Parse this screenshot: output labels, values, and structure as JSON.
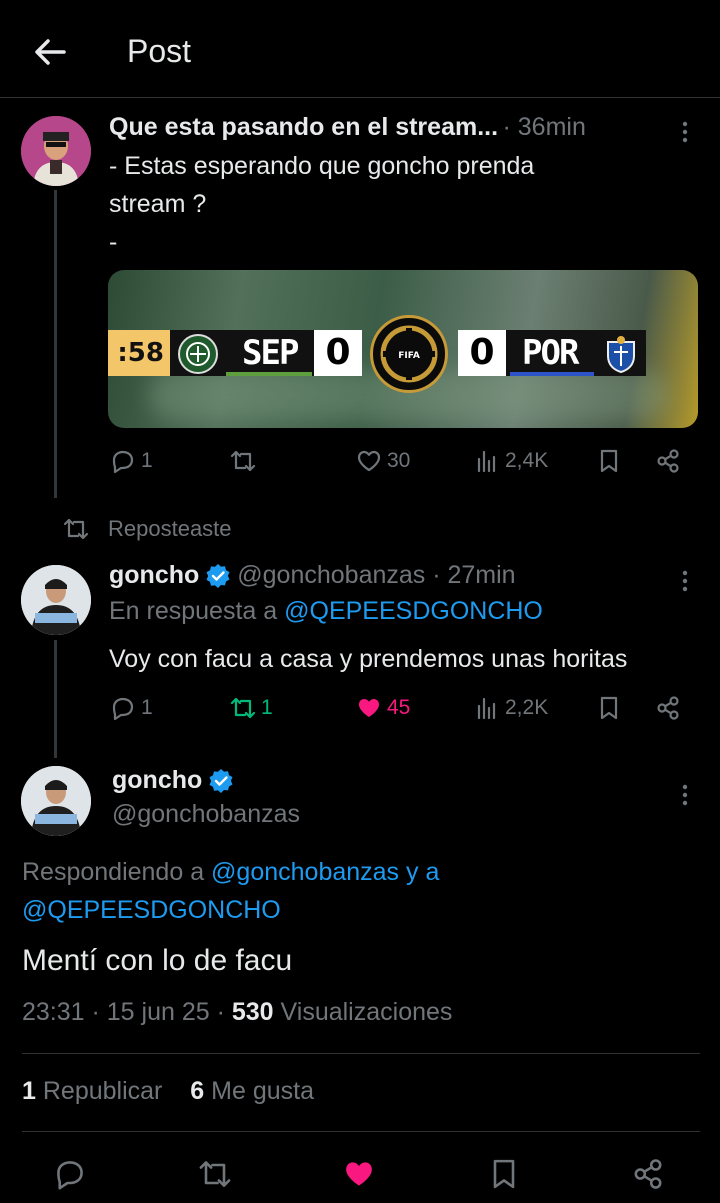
{
  "header": {
    "title": "Post"
  },
  "tweet1": {
    "name": "Que esta pasando en el stream...",
    "time": "· 36min",
    "text_line1": "- Estas esperando que goncho prenda",
    "text_line2": "stream ?",
    "text_line3": "-",
    "media": {
      "clock": ":58",
      "team_home": "SEP",
      "score_home": "0",
      "team_away": "POR",
      "score_away": "0",
      "center_logo": "FIFA"
    },
    "actions": {
      "replies": "1",
      "reposts": "",
      "likes": "30",
      "views": "2,4K"
    }
  },
  "repost_label": "Reposteaste",
  "tweet2": {
    "name": "goncho",
    "handle_time": "@gonchobanzas · 27min",
    "reply_prefix": "En respuesta a",
    "reply_to": "@QEPEESDGONCHO",
    "text": "Voy con facu a casa y prendemos unas horitas",
    "actions": {
      "replies": "1",
      "reposts": "1",
      "likes": "45",
      "views": "2,2K"
    }
  },
  "main": {
    "name": "goncho",
    "handle": "@gonchobanzas",
    "replying_prefix": "Respondiendo a",
    "replying_to1": "@gonchobanzas y a",
    "replying_to2": "@QEPEESDGONCHO",
    "text": "Mentí con lo de facu",
    "time": "23:31 · 15 jun 25 ·",
    "views_count": "530",
    "views_label": "Visualizaciones",
    "reposts_count": "1",
    "reposts_label": "Republicar",
    "likes_count": "6",
    "likes_label": "Me gusta"
  },
  "colors": {
    "accent": "#1d9bf0",
    "like": "#f91880",
    "repost": "#00ba7c",
    "muted": "#71767b"
  }
}
